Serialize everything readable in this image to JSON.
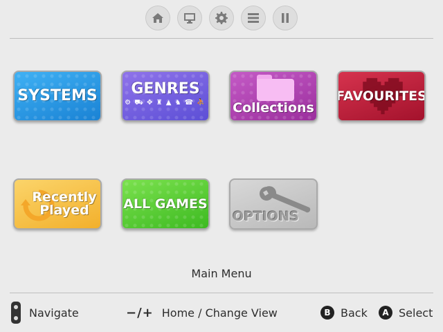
{
  "toolbar": {
    "buttons": [
      {
        "icon": "home-icon"
      },
      {
        "icon": "monitor-icon"
      },
      {
        "icon": "gear-icon"
      },
      {
        "icon": "menu-icon"
      },
      {
        "icon": "pause-icon"
      }
    ]
  },
  "tiles": {
    "systems": "SYSTEMS",
    "genres": "GENRES",
    "genre_icons": "⚙ ⛟ ✥ ♜ ▲ ♞ ☎ ⛹",
    "collections": "Collections",
    "favourites": "FAVOURITES",
    "recently_played": "Recently\nPlayed",
    "all_games": "ALL GAMES",
    "options": "OPTIONS"
  },
  "menu_title": "Main Menu",
  "hints": {
    "navigate": "Navigate",
    "home_symbol": "−/+",
    "home": "Home / Change View",
    "back_button": "B",
    "back": "Back",
    "select_button": "A",
    "select": "Select"
  },
  "colors": {
    "background": "#ebebeb",
    "systems": "#2a9ae6",
    "genres": "#7462e0",
    "collections": "#b545b8",
    "favourites": "#c0233e",
    "recently_played": "#f6c24a",
    "all_games": "#57cc37",
    "options": "#c8c8c8"
  }
}
